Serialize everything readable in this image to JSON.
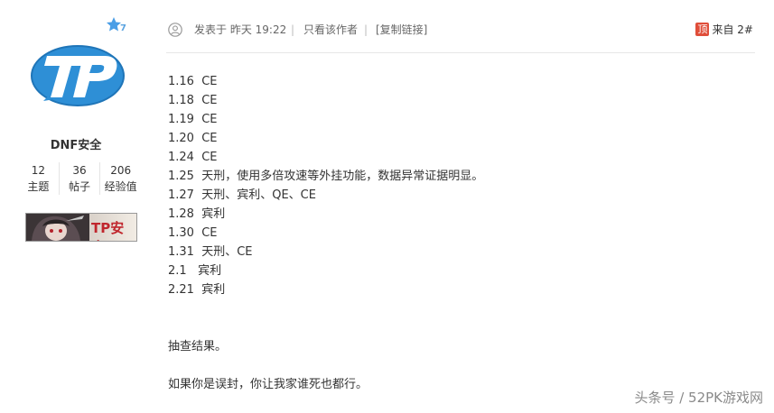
{
  "author": {
    "level": "7",
    "avatar_text": "TP",
    "name": "DNF安全",
    "stats": [
      {
        "value": "12",
        "label": "主题"
      },
      {
        "value": "36",
        "label": "帖子"
      },
      {
        "value": "206",
        "label": "经验值"
      }
    ],
    "medal_text": "TP安全"
  },
  "post_header": {
    "posted": "发表于 昨天 19:22",
    "only_author": "只看该作者",
    "copy_link": "[复制链接]",
    "separator": "|",
    "top_icon": "顶",
    "floor": "来自 2#"
  },
  "content": {
    "lines": [
      "1.16  CE",
      "1.18  CE",
      "1.19  CE",
      "1.20  CE",
      "1.24  CE",
      "1.25  天刑，使用多倍攻速等外挂功能，数据异常证据明显。",
      "1.27  天刑、宾利、QE、CE",
      "1.28  宾利",
      "1.30  CE",
      "1.31  天刑、CE",
      "2.1   宾利",
      "2.21  宾利"
    ],
    "result": "抽查结果。",
    "closing": "如果你是误封，你让我家谁死也都行。"
  },
  "watermark": "头条号 / 52PK游戏网",
  "colors": {
    "avatar_blue": "#2e8fd6",
    "top_icon_red": "#e04e3a",
    "medal_red": "#c0262d"
  }
}
